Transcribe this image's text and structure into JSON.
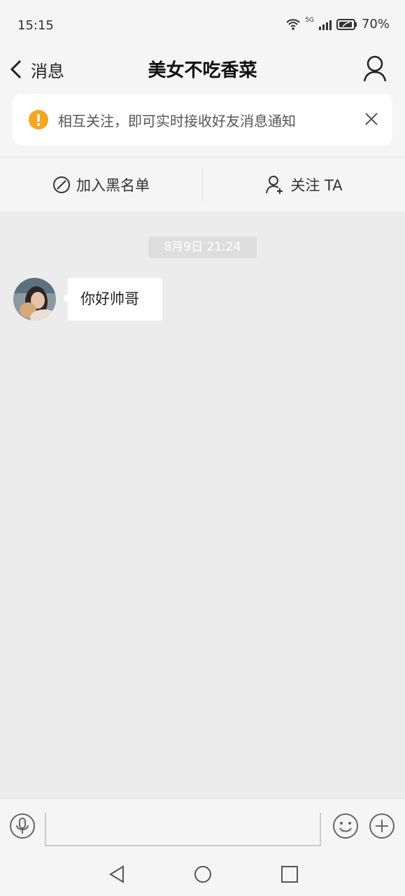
{
  "status": {
    "time": "15:15",
    "signal": "5G",
    "battery": "70%"
  },
  "header": {
    "back_label": "消息",
    "title": "美女不吃香菜",
    "profile_icon": "person-icon"
  },
  "notice": {
    "text": "相互关注，即可实时接收好友消息通知",
    "icon": "warning-icon",
    "icon_color": "#f5a623"
  },
  "actions": {
    "blacklist": "加入黑名单",
    "follow": "关注 TA"
  },
  "chat": {
    "timestamp": "8月9日 21:24",
    "messages": [
      {
        "sender": "other",
        "text": "你好帅哥"
      }
    ]
  },
  "input": {
    "placeholder": ""
  }
}
